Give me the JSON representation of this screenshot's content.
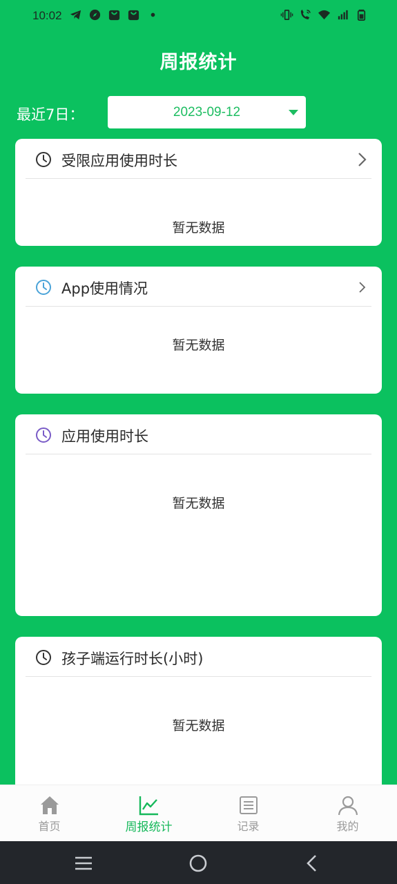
{
  "status_bar": {
    "time": "10:02",
    "left_icons": [
      "telegram-icon",
      "compass-icon",
      "bag-icon",
      "bag-icon",
      "dot-icon"
    ],
    "right_icons": [
      "vibrate-icon",
      "wifi-call-icon",
      "wifi-icon",
      "signal-icon",
      "battery-icon"
    ]
  },
  "header": {
    "title": "周报统计"
  },
  "date_filter": {
    "label": "最近7日：",
    "selected": "2023-09-12"
  },
  "cards": [
    {
      "title": "受限应用使用时长",
      "icon": "clock-icon",
      "icon_color": "#333333",
      "has_chevron": true,
      "empty_text": "暂无数据"
    },
    {
      "title": "App使用情况",
      "icon": "clock-icon",
      "icon_color": "#4aa3d8",
      "has_chevron": true,
      "empty_text": "暂无数据"
    },
    {
      "title": "应用使用时长",
      "icon": "clock-icon",
      "icon_color": "#7a5cc7",
      "has_chevron": false,
      "empty_text": "暂无数据"
    },
    {
      "title": "孩子端运行时长(小时)",
      "icon": "clock-icon",
      "icon_color": "#333333",
      "has_chevron": false,
      "empty_text": "暂无数据"
    }
  ],
  "tabs": [
    {
      "label": "首页",
      "icon": "home-icon",
      "active": false
    },
    {
      "label": "周报统计",
      "icon": "chart-icon",
      "active": true
    },
    {
      "label": "记录",
      "icon": "list-icon",
      "active": false
    },
    {
      "label": "我的",
      "icon": "user-icon",
      "active": false
    }
  ],
  "colors": {
    "brand_green": "#0bc15f",
    "active_tab": "#15b85a",
    "inactive_tab": "#9a9a9a"
  }
}
